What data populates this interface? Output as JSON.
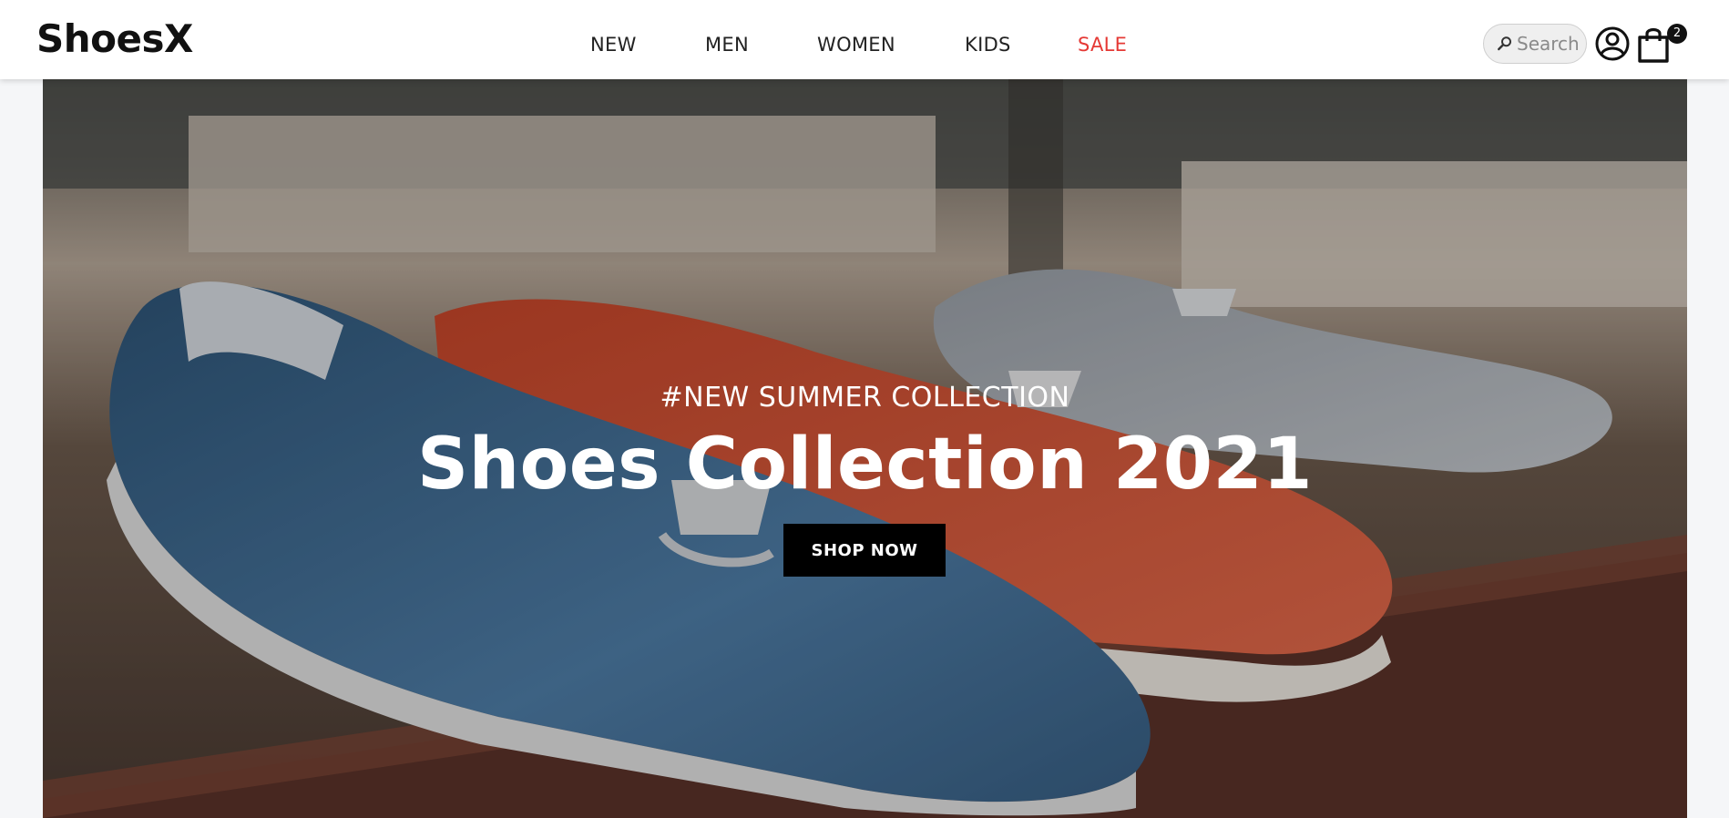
{
  "header": {
    "logo": "ShoesX",
    "nav": [
      {
        "label": "NEW"
      },
      {
        "label": "MEN"
      },
      {
        "label": "WOMEN"
      },
      {
        "label": "KIDS"
      },
      {
        "label": "SALE"
      }
    ],
    "search": {
      "placeholder": "Search",
      "value": ""
    },
    "cart": {
      "count": "2"
    }
  },
  "hero": {
    "subtitle": "#NEW SUMMER COLLECTION",
    "title": "Shoes Collection 2021",
    "cta_label": "SHOP NOW"
  },
  "colors": {
    "sale": "#e53935",
    "button_bg": "#000000",
    "header_bg": "#ffffff",
    "shoe_blue": "#3d6a93",
    "shoe_red": "#d9583a",
    "shoe_grey": "#a9adb3"
  },
  "icons": {
    "search": "search-icon",
    "user": "user-icon",
    "cart": "shopping-bag-icon"
  }
}
